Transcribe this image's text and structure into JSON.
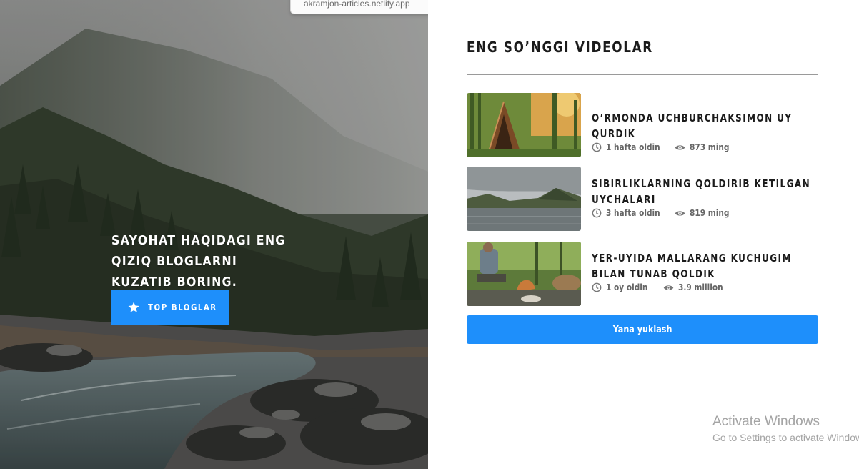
{
  "browser": {
    "status_url": "akramjon-articles.netlify.app"
  },
  "hero": {
    "heading": "SAYOHAT HAQIDAGI ENG QIZIQ BLOGLARNI KUZATIB BORING.",
    "button_label": "TOP BLOGLAR",
    "button_icon": "star-icon",
    "accent_color": "#1e8ffb"
  },
  "videos_panel": {
    "title": "ENG SO’NGGI VIDEOLAR",
    "videos": [
      {
        "title": "O’RMONDA UCHBURCHAKSIMON UY QURDIK",
        "time_ago": "1 hafta oldin",
        "views": "873 ming"
      },
      {
        "title": "SIBIRLIKLARNING QOLDIRIB KETILGAN UYCHALARI",
        "time_ago": "3 hafta oldin",
        "views": "819 ming"
      },
      {
        "title": "YER-UYIDA MALLARANG KUCHUGIM BILAN TUNAB QOLDIK",
        "time_ago": "1 oy oldin",
        "views": "3.9 million"
      }
    ],
    "load_more_label": "Yana yuklash",
    "icons": {
      "time": "clock-icon",
      "views": "eye-icon"
    }
  },
  "os_watermark": {
    "line1": "Activate Windows",
    "line2": "Go to Settings to activate Windows."
  }
}
